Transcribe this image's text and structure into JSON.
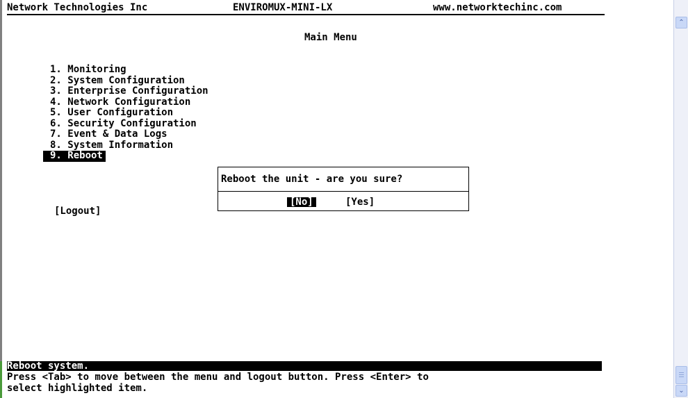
{
  "header": {
    "company": "Network Technologies Inc",
    "product": "ENVIROMUX-MINI-LX",
    "website": "www.networktechinc.com"
  },
  "menu": {
    "title": "Main Menu",
    "items": [
      {
        "label": "1. Monitoring"
      },
      {
        "label": "2. System Configuration"
      },
      {
        "label": "3. Enterprise Configuration"
      },
      {
        "label": "4. Network Configuration"
      },
      {
        "label": "5. User Configuration"
      },
      {
        "label": "6. Security Configuration"
      },
      {
        "label": "7. Event & Data Logs"
      },
      {
        "label": "8. System Information"
      },
      {
        "label": "9. Reboot",
        "selected": true
      }
    ],
    "logout_label": "[Logout]"
  },
  "dialog": {
    "question": "Reboot the unit - are you sure?",
    "no_label": "[No]",
    "yes_label": "[Yes]"
  },
  "status_bar": {
    "status": "Reboot system.",
    "help": "Press <Tab> to move between the menu and logout button. Press <Enter> to\nselect highlighted item."
  },
  "colors": {
    "background": "#ffffff",
    "text": "#000000",
    "highlight_bg": "#000000",
    "highlight_text": "#ffffff"
  },
  "icons": {
    "scroll_up": "chevron-up-icon",
    "scroll_down": "chevron-down-icon"
  }
}
